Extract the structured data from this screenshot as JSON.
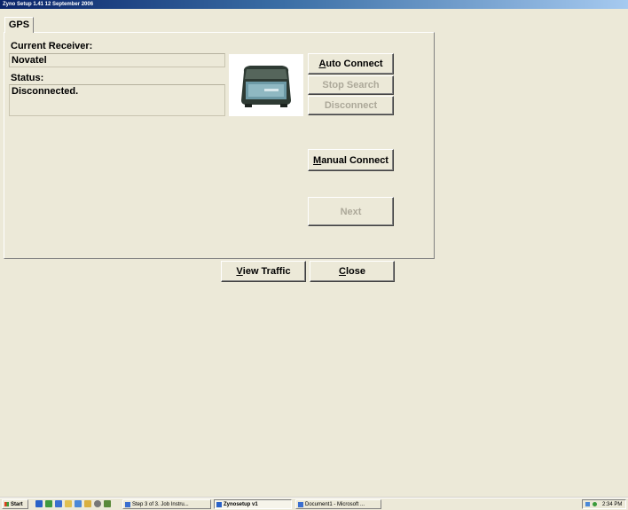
{
  "window": {
    "title": "Zyno Setup 1.41 12 September 2006"
  },
  "tab": {
    "label": "GPS"
  },
  "receiver": {
    "label": "Current Receiver:",
    "value": "Novatel"
  },
  "status": {
    "label": "Status:",
    "value": "Disconnected."
  },
  "buttons": {
    "auto_connect": {
      "mnemonic": "A",
      "rest": "uto Connect",
      "enabled": true
    },
    "stop_search": {
      "label": "Stop Search",
      "enabled": false
    },
    "disconnect": {
      "label": "Disconnect",
      "enabled": false
    },
    "manual_connect": {
      "mnemonic": "M",
      "rest": "anual Connect",
      "enabled": true
    },
    "next": {
      "label": "Next",
      "enabled": false
    },
    "view_traffic": {
      "mnemonic": "V",
      "rest": "iew Traffic",
      "enabled": true
    },
    "close": {
      "mnemonic": "C",
      "rest": "lose",
      "enabled": true
    }
  },
  "taskbar": {
    "start_label": "Start",
    "tasks": [
      {
        "label": "Step 3 of 3. Job Instru...",
        "active": false
      },
      {
        "label": "Zynosetup v1",
        "active": true
      },
      {
        "label": "Document1 - Microsoft ...",
        "active": false
      }
    ],
    "clock": "2:34 PM"
  },
  "colors": {
    "title_start": "#0a246a",
    "title_end": "#a6caf0",
    "face": "#ece9d8"
  }
}
